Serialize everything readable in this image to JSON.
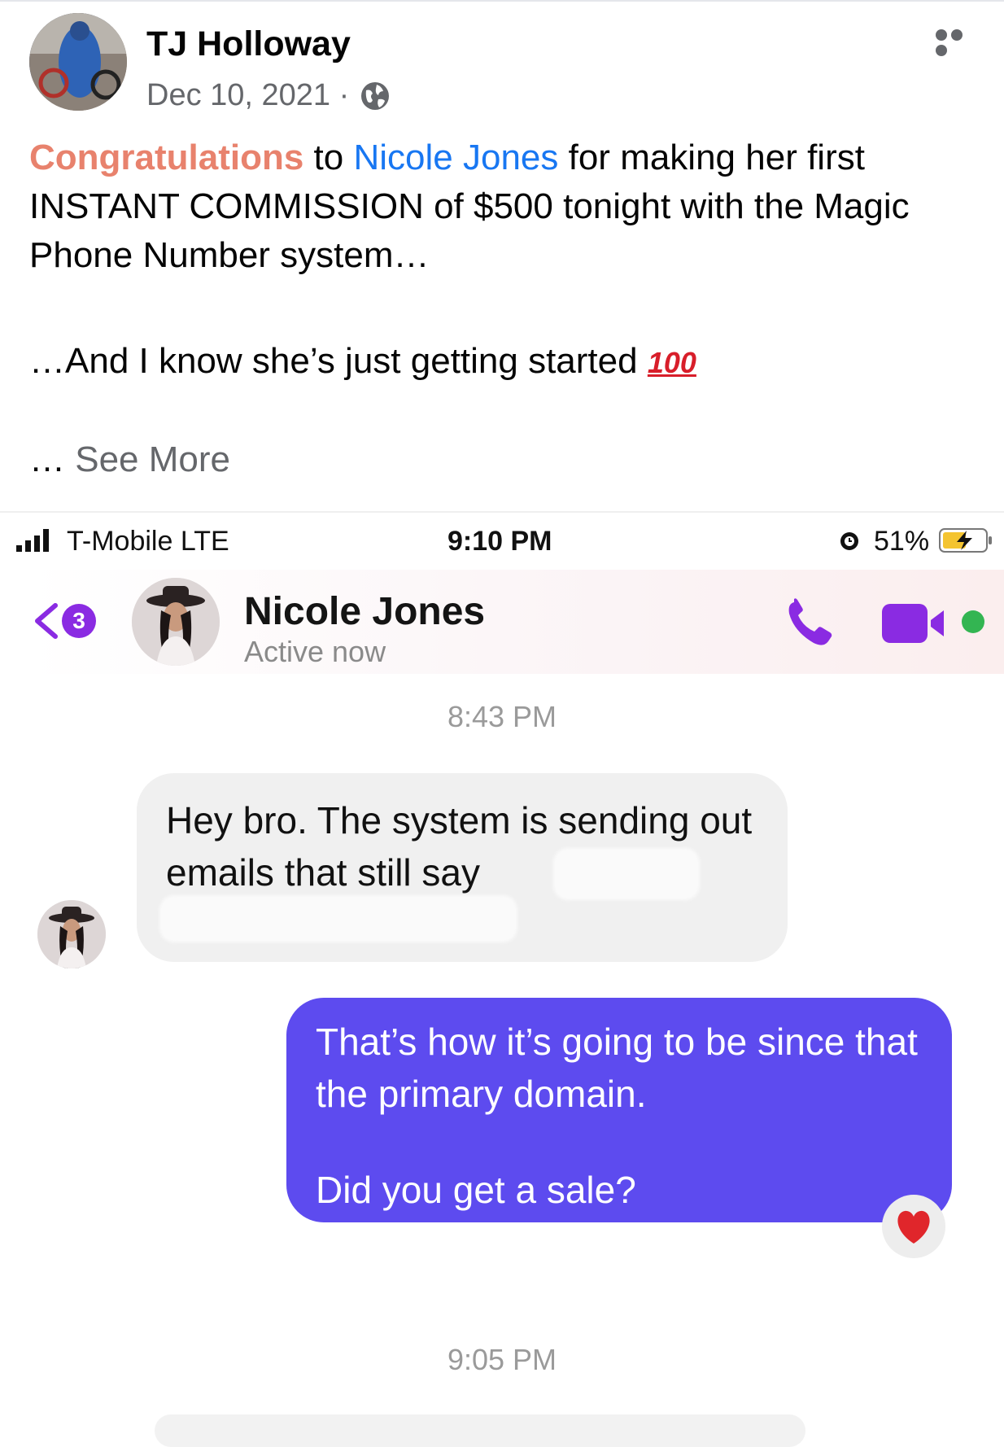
{
  "post": {
    "author": "TJ Holloway",
    "date": "Dec 10, 2021 ·",
    "privacy_icon": "globe-icon",
    "more_icon": "more-options-icon",
    "text": {
      "congrats": "Congratulations",
      "to": " to ",
      "mention": "Nicole Jones",
      "rest": " for making her first INSTANT COMMISSION of $500 tonight with the Magic Phone Number system…",
      "line2": "…And I know she’s just getting started ",
      "emoji": "100",
      "see_more_dots": "… ",
      "see_more": "See More"
    }
  },
  "screenshot": {
    "status_bar": {
      "carrier": "T-Mobile  LTE",
      "time": "9:10 PM",
      "battery": "51%"
    },
    "chat_header": {
      "back_badge": "3",
      "name": "Nicole Jones",
      "status": "Active now",
      "accent_color": "#8a2be2",
      "online_color": "#33b552"
    },
    "messages": {
      "ts1": "8:43 PM",
      "incoming": "Hey bro. The system is sending out emails that still say",
      "outgoing_line1": "That’s how it’s going to be since that the primary domain.",
      "outgoing_line2": "Did you get a sale?",
      "outgoing_color": "#5d4bef",
      "reaction": "heart-icon",
      "ts2": "9:05 PM"
    }
  }
}
